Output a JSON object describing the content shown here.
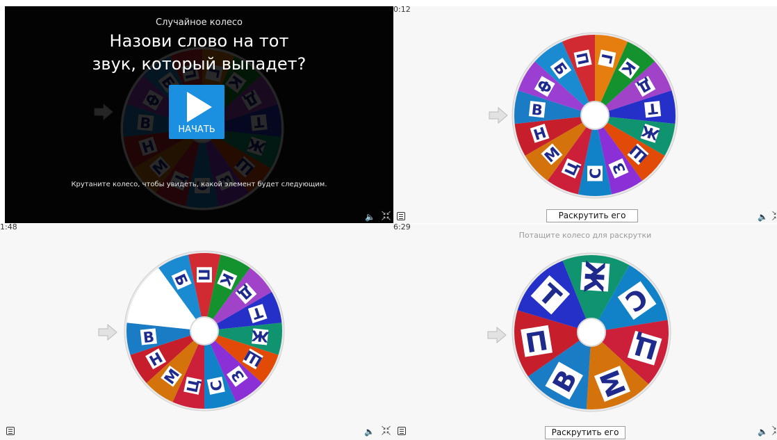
{
  "panels": [
    {
      "timer": "",
      "hint": "",
      "overlay": {
        "subtitle": "Случайное колесо",
        "title_line1": "Назови слово на тот",
        "title_line2": "звук, который выпадет?",
        "start_label": "НАЧАТЬ",
        "footer": "Крутаните колесо, чтобы увидеть, какой элемент будет следующим."
      },
      "wheel": {
        "highlight_index": -1,
        "segments": [
          {
            "letter": "П",
            "color": "#d22a33"
          },
          {
            "letter": "Г",
            "color": "#e67e0f"
          },
          {
            "letter": "К",
            "color": "#13922d"
          },
          {
            "letter": "Д",
            "color": "#a143c8"
          },
          {
            "letter": "Т",
            "color": "#2530c8"
          },
          {
            "letter": "Ж",
            "color": "#109470"
          },
          {
            "letter": "Ш",
            "color": "#e24a08"
          },
          {
            "letter": "З",
            "color": "#8b30d7"
          },
          {
            "letter": "С",
            "color": "#1182c8"
          },
          {
            "letter": "Ц",
            "color": "#cc1f3a"
          },
          {
            "letter": "М",
            "color": "#d4720b"
          },
          {
            "letter": "Н",
            "color": "#c61f2b"
          },
          {
            "letter": "В",
            "color": "#1a7cc5"
          },
          {
            "letter": "Ф",
            "color": "#9b3fd3"
          },
          {
            "letter": "Б",
            "color": "#1a8bd0"
          }
        ]
      },
      "spin_label": ""
    },
    {
      "timer": "0:12",
      "hint": "",
      "overlay": null,
      "wheel": {
        "highlight_index": -1,
        "segments": [
          {
            "letter": "П",
            "color": "#d22a33"
          },
          {
            "letter": "Г",
            "color": "#e67e0f"
          },
          {
            "letter": "К",
            "color": "#13922d"
          },
          {
            "letter": "Д",
            "color": "#a143c8"
          },
          {
            "letter": "Т",
            "color": "#2530c8"
          },
          {
            "letter": "Ж",
            "color": "#109470"
          },
          {
            "letter": "Ш",
            "color": "#e24a08"
          },
          {
            "letter": "З",
            "color": "#8b30d7"
          },
          {
            "letter": "С",
            "color": "#1182c8"
          },
          {
            "letter": "Ц",
            "color": "#cc1f3a"
          },
          {
            "letter": "М",
            "color": "#d4720b"
          },
          {
            "letter": "Н",
            "color": "#c61f2b"
          },
          {
            "letter": "В",
            "color": "#1a7cc5"
          },
          {
            "letter": "Ф",
            "color": "#9b3fd3"
          },
          {
            "letter": "Б",
            "color": "#1a8bd0"
          }
        ]
      },
      "spin_label": "Раскрутить его"
    },
    {
      "timer": "1:48",
      "hint": "",
      "overlay": null,
      "wheel": {
        "highlight_index": 13,
        "segments": [
          {
            "letter": "П",
            "color": "#d22a33"
          },
          {
            "letter": "К",
            "color": "#13922d"
          },
          {
            "letter": "Д",
            "color": "#a143c8"
          },
          {
            "letter": "Т",
            "color": "#2530c8"
          },
          {
            "letter": "Ж",
            "color": "#109470"
          },
          {
            "letter": "Ш",
            "color": "#e24a08"
          },
          {
            "letter": "З",
            "color": "#8b30d7"
          },
          {
            "letter": "С",
            "color": "#1182c8"
          },
          {
            "letter": "Ц",
            "color": "#cc1f3a"
          },
          {
            "letter": "М",
            "color": "#d4720b"
          },
          {
            "letter": "Н",
            "color": "#c61f2b"
          },
          {
            "letter": "В",
            "color": "#1a7cc5"
          },
          {
            "letter": "",
            "color": "#ffffff"
          },
          {
            "letter": "",
            "color": "#ffffff"
          },
          {
            "letter": "Б",
            "color": "#1a8bd0"
          }
        ]
      },
      "spin_label": ""
    },
    {
      "timer": "6:29",
      "hint": "Потащите колесо для раскрутки",
      "overlay": null,
      "wheel": {
        "highlight_index": -1,
        "segments": [
          {
            "letter": "Ж",
            "color": "#109470"
          },
          {
            "letter": "С",
            "color": "#1182c8"
          },
          {
            "letter": "Ц",
            "color": "#cc1f3a"
          },
          {
            "letter": "М",
            "color": "#d4720b"
          },
          {
            "letter": "В",
            "color": "#1a7cc5"
          },
          {
            "letter": "П",
            "color": "#c61f2b"
          },
          {
            "letter": "Т",
            "color": "#2530c8"
          }
        ]
      },
      "spin_label": "Раскрутить его"
    }
  ],
  "icons": {
    "sound": "speaker-icon",
    "fullscreen": "fullscreen-exit-icon",
    "menu": "menu-icon"
  }
}
